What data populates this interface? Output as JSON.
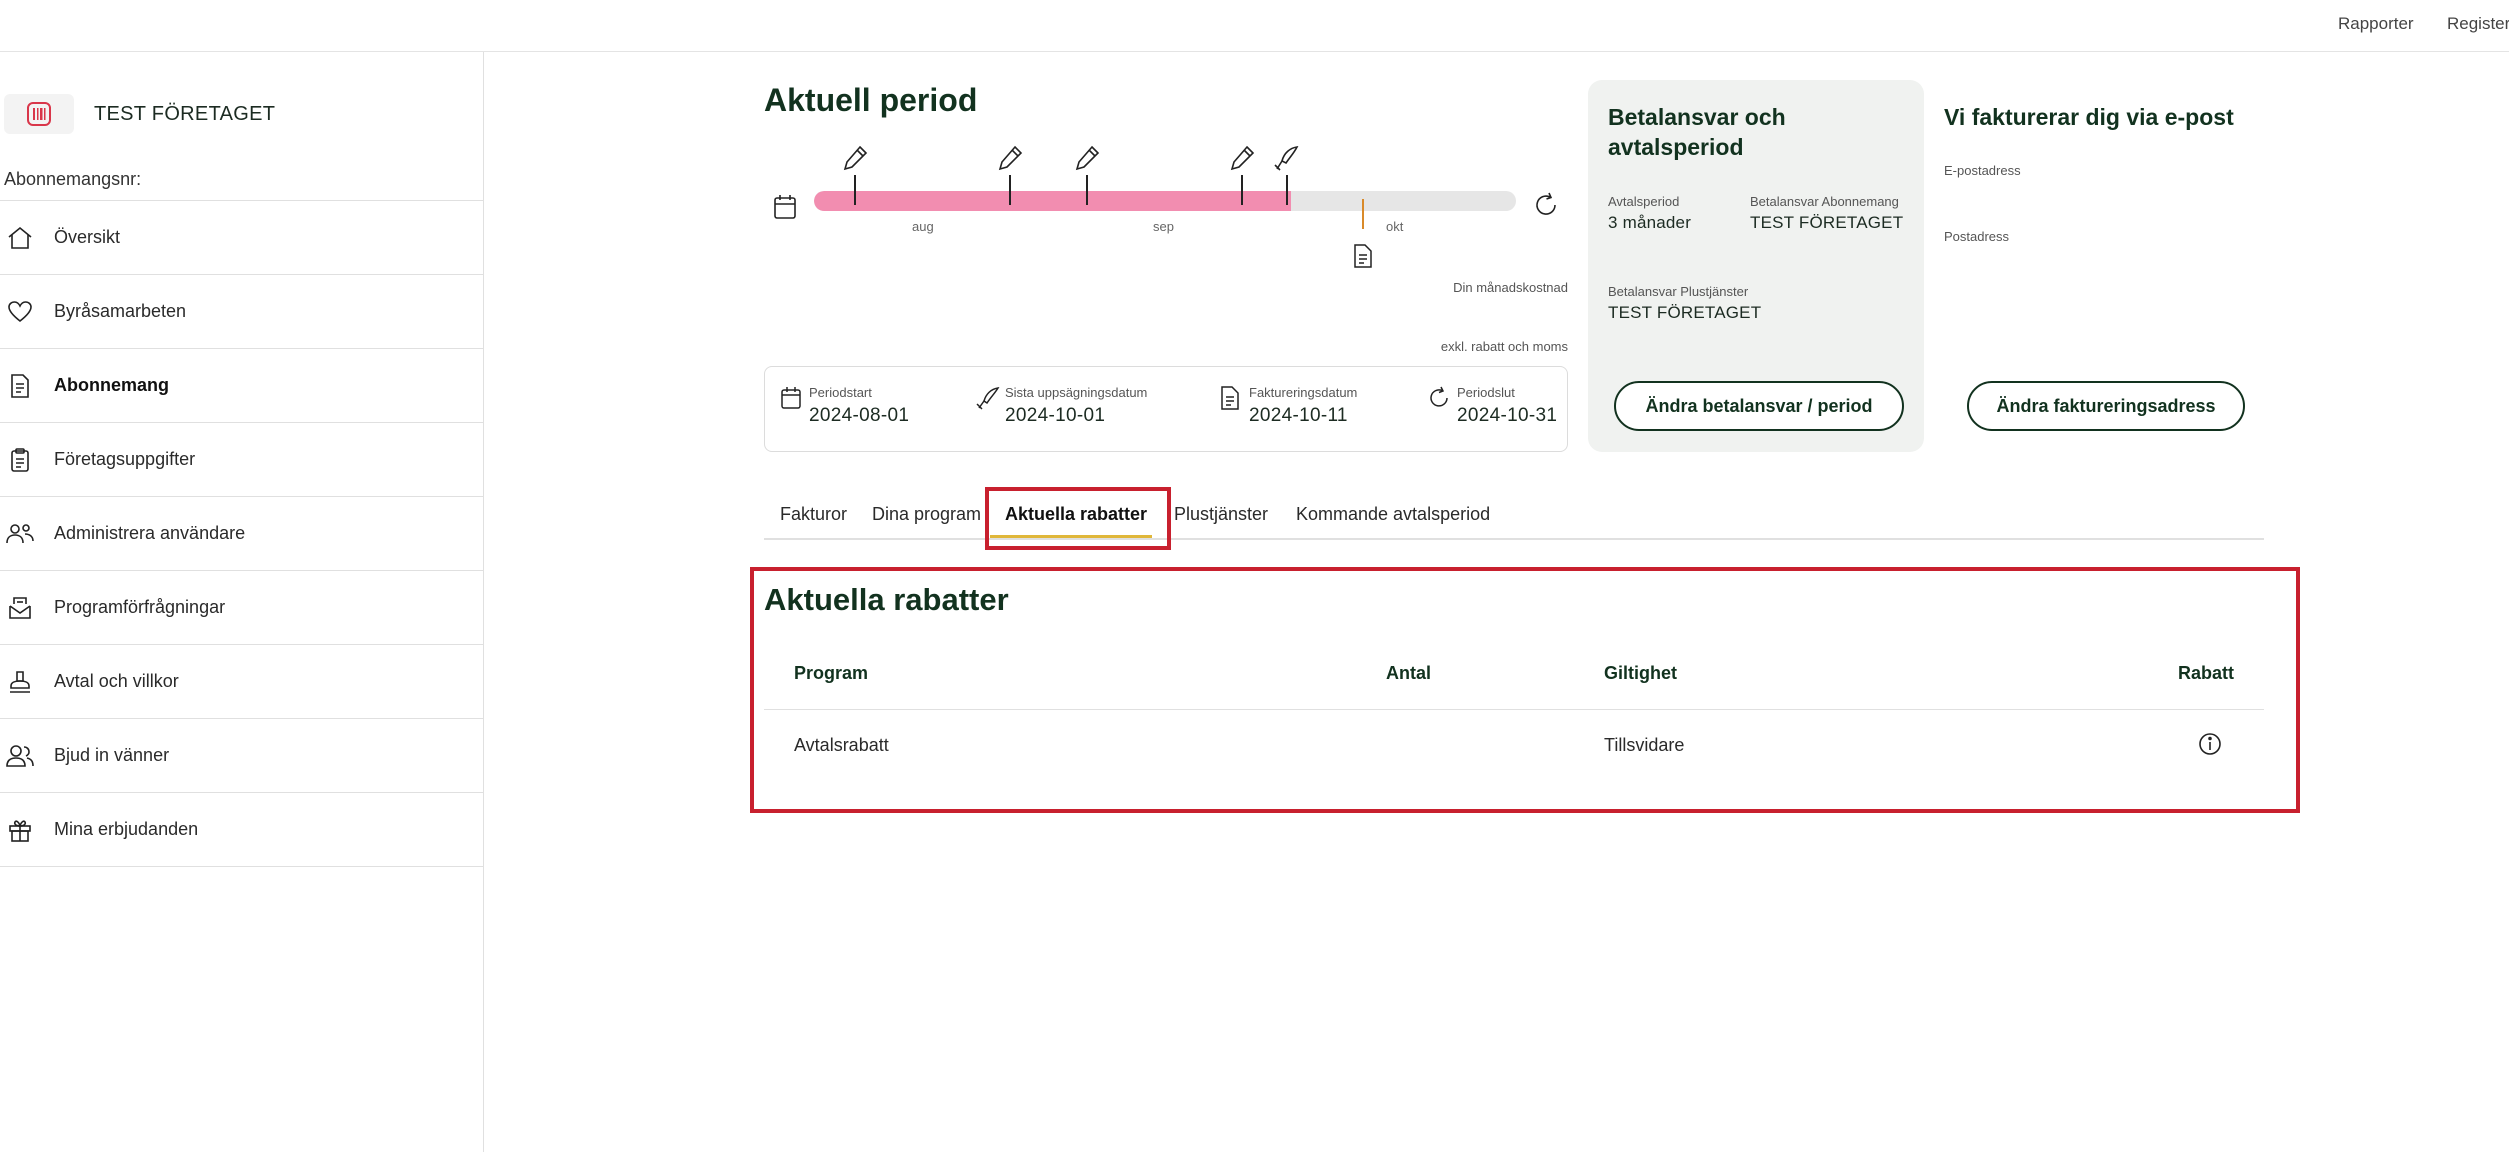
{
  "topbar": {
    "reports": "Rapporter",
    "register": "Register"
  },
  "sidebar": {
    "company_name": "TEST FÖRETAGET",
    "subscription_label": "Abonnemangsnr:",
    "items": [
      {
        "label": "Översikt",
        "icon": "home-icon"
      },
      {
        "label": "Byråsamarbeten",
        "icon": "heart-icon"
      },
      {
        "label": "Abonnemang",
        "icon": "document-icon"
      },
      {
        "label": "Företagsuppgifter",
        "icon": "clipboard-icon"
      },
      {
        "label": "Administrera användare",
        "icon": "users-settings-icon"
      },
      {
        "label": "Programförfrågningar",
        "icon": "inbox-icon"
      },
      {
        "label": "Avtal och villkor",
        "icon": "stamp-icon"
      },
      {
        "label": "Bjud in vänner",
        "icon": "people-icon"
      },
      {
        "label": "Mina erbjudanden",
        "icon": "gift-icon"
      }
    ]
  },
  "period": {
    "title": "Aktuell period",
    "months": [
      "aug",
      "sep",
      "okt"
    ],
    "progress": 0.68,
    "monthly_cost_label": "Din månadskostnad",
    "monthly_cost_sub": "exkl. rabatt och moms",
    "start_label": "Periodstart",
    "start_value": "2024-08-01",
    "cancel_label": "Sista uppsägningsdatum",
    "cancel_value": "2024-10-01",
    "invoice_label": "Faktureringsdatum",
    "invoice_value": "2024-10-11",
    "end_label": "Periodslut",
    "end_value": "2024-10-31"
  },
  "billing": {
    "title": "Betalansvar och avtalsperiod",
    "agreement_label": "Avtalsperiod",
    "agreement_value": "3 månader",
    "payer_sub_label": "Betalansvar Abonnemang",
    "payer_sub_value": "TEST FÖRETAGET",
    "payer_plus_label": "Betalansvar Plustjänster",
    "payer_plus_value": "TEST FÖRETAGET",
    "button": "Ändra betalansvar / period"
  },
  "invoice_info": {
    "title": "Vi fakturerar dig via e-post",
    "email_label": "E-postadress",
    "postal_label": "Postadress",
    "button": "Ändra faktureringsadress"
  },
  "tabs": [
    "Fakturor",
    "Dina program",
    "Aktuella rabatter",
    "Plustjänster",
    "Kommande avtalsperiod"
  ],
  "discounts": {
    "title": "Aktuella rabatter",
    "headers": {
      "program": "Program",
      "count": "Antal",
      "validity": "Giltighet",
      "discount": "Rabatt"
    },
    "rows": [
      {
        "program": "Avtalsrabatt",
        "count": "",
        "validity": "Tillsvidare"
      }
    ]
  },
  "colors": {
    "brand": "#12321f",
    "progress": "#f28db0",
    "highlight": "#c8202e",
    "tab_underline": "#e0b73a"
  }
}
